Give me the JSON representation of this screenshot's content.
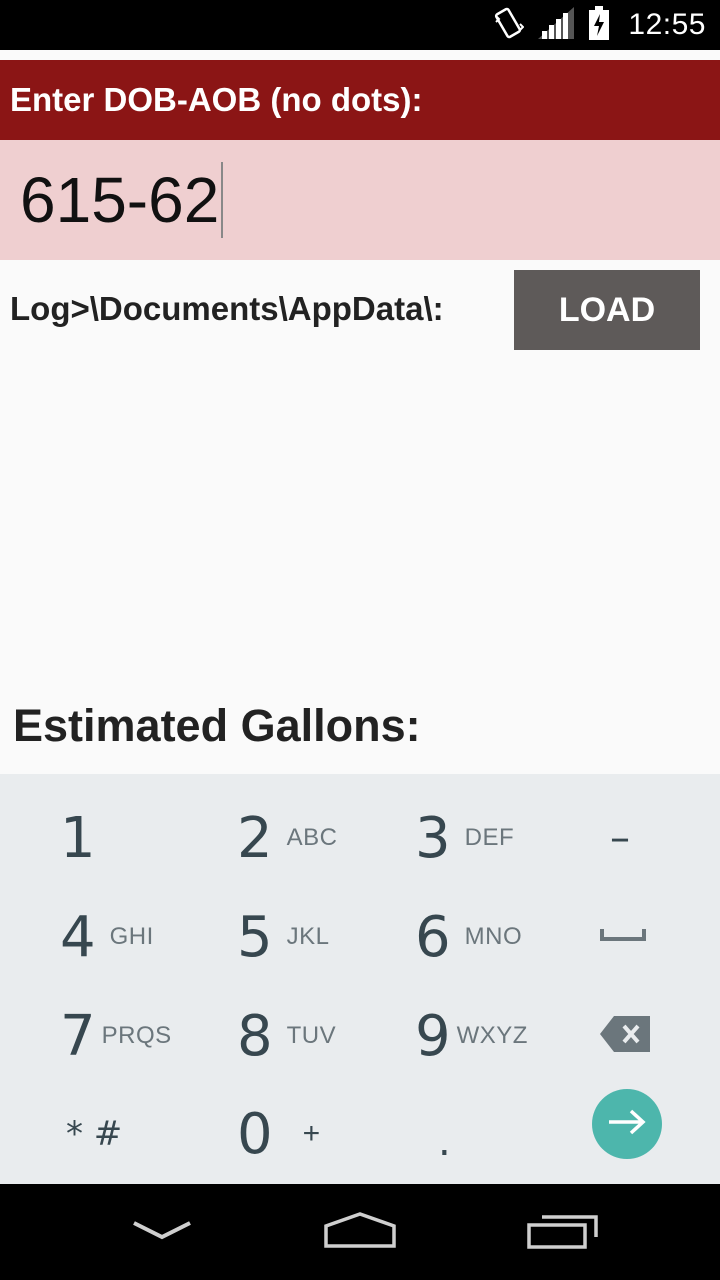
{
  "status_bar": {
    "time": "12:55",
    "icons": [
      "vibrate-icon",
      "signal-icon",
      "battery-charging-icon"
    ]
  },
  "form": {
    "prompt": "Enter DOB-AOB (no dots):",
    "input_value": "615-62",
    "log_path_label": "Log>\\Documents\\AppData\\:",
    "load_button_label": "LOAD",
    "gallons_label": "Estimated Gallons:"
  },
  "keyboard": {
    "rows": [
      [
        {
          "num": "1",
          "letters": ""
        },
        {
          "num": "2",
          "letters": "ABC"
        },
        {
          "num": "3",
          "letters": "DEF"
        },
        {
          "num": "–",
          "letters": ""
        }
      ],
      [
        {
          "num": "4",
          "letters": "GHI"
        },
        {
          "num": "5",
          "letters": "JKL"
        },
        {
          "num": "6",
          "letters": "MNO"
        },
        {
          "num": "",
          "letters": ""
        }
      ],
      [
        {
          "num": "7",
          "letters": "PRQS"
        },
        {
          "num": "8",
          "letters": "TUV"
        },
        {
          "num": "9",
          "letters": "WXYZ"
        },
        {
          "num": "",
          "letters": ""
        }
      ],
      [
        {
          "num": "* #",
          "letters": ""
        },
        {
          "num": "0",
          "letters": "+"
        },
        {
          "num": ".",
          "letters": ""
        },
        {
          "num": "",
          "letters": ""
        }
      ]
    ],
    "space_key_icon": "space-icon",
    "delete_key_icon": "backspace-icon",
    "enter_key_icon": "arrow-right-icon",
    "accent_color": "#4db6ac"
  },
  "nav_bar": {
    "icons": [
      "back-icon",
      "home-icon",
      "recents-icon"
    ]
  },
  "colors": {
    "prompt_bar": "#8b1515",
    "input_background": "#efcfd0",
    "load_button": "#5e5a59"
  }
}
